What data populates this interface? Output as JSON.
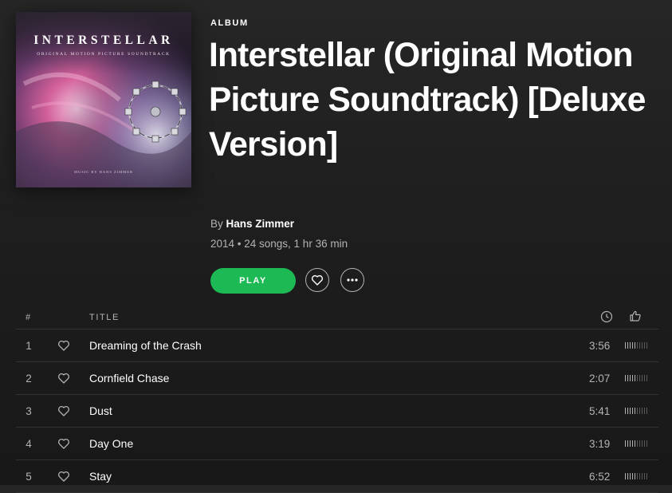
{
  "album": {
    "type_label": "ALBUM",
    "title": "Interstellar (Original Motion Picture Soundtrack) [Deluxe Version]",
    "by_prefix": "By",
    "artist": "Hans Zimmer",
    "meta": "2014 • 24 songs, 1 hr 36 min",
    "cover": {
      "title": "INTERSTELLAR",
      "subtitle": "ORIGINAL MOTION PICTURE SOUNDTRACK",
      "credit": "MUSIC BY HANS ZIMMER"
    }
  },
  "actions": {
    "play_label": "PLAY",
    "like_icon": "heart-outline-icon",
    "more_icon": "ellipsis-icon"
  },
  "colors": {
    "accent": "#1db954",
    "text_secondary": "#b3b3b3"
  },
  "tracklist": {
    "header": {
      "num": "#",
      "title": "TITLE",
      "duration_icon": "clock-icon",
      "popularity_icon": "thumbs-up-icon"
    },
    "tracks": [
      {
        "num": "1",
        "title": "Dreaming of the Crash",
        "duration": "3:56",
        "popularity": 0.5
      },
      {
        "num": "2",
        "title": "Cornfield Chase",
        "duration": "2:07",
        "popularity": 0.5
      },
      {
        "num": "3",
        "title": "Dust",
        "duration": "5:41",
        "popularity": 0.5
      },
      {
        "num": "4",
        "title": "Day One",
        "duration": "3:19",
        "popularity": 0.5
      },
      {
        "num": "5",
        "title": "Stay",
        "duration": "6:52",
        "popularity": 0.5
      }
    ]
  }
}
